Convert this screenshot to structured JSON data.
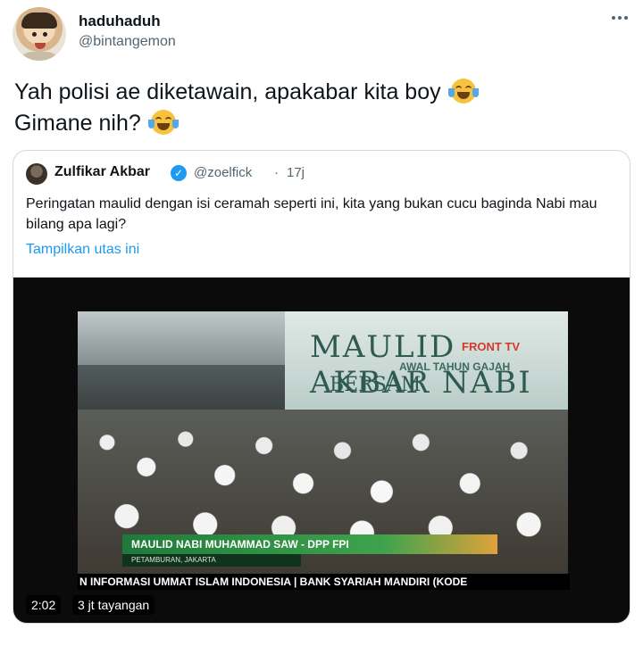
{
  "tweet": {
    "author_name": "haduhaduh",
    "author_handle": "@bintangemon",
    "text_line1": "Yah polisi ae diketawain, apakabar kita boy",
    "text_line2": "Gimane nih?",
    "emoji": "face-with-tears-of-joy"
  },
  "quoted": {
    "author_name": "Zulfikar Akbar",
    "author_handle": "@zoelfick",
    "separator": "·",
    "time": "17j",
    "text": "Peringatan maulid dengan isi ceramah seperti ini, kita yang bukan cucu baginda Nabi mau bilang apa lagi?",
    "show_thread_label": "Tampilkan utas ini",
    "video": {
      "banner_main": "MAULID AKBAR NABI",
      "banner_sub": "AWAL TAHUN GAJAH",
      "banner_left": "BERSAM",
      "channel_logo": "FRONT TV",
      "lower_third_title": "MAULID NABI MUHAMMAD SAW - DPP FPI",
      "lower_third_location": "PETAMBURAN, JAKARTA",
      "ticker": "N INFORMASI UMMAT ISLAM INDONESIA | BANK SYARIAH MANDIRI (KODE",
      "duration": "2:02",
      "views": "3 jt tayangan"
    }
  },
  "colors": {
    "link": "#1d9bf0",
    "secondary_text": "#536471",
    "verified": "#1d9bf0"
  }
}
